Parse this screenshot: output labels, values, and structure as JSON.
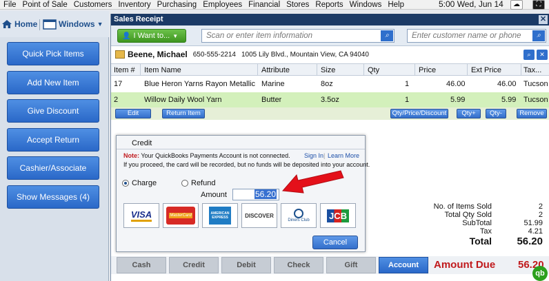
{
  "menu": [
    "File",
    "Point of Sale",
    "Customers",
    "Inventory",
    "Purchasing",
    "Employees",
    "Financial",
    "Stores",
    "Reports",
    "Windows",
    "Help"
  ],
  "clock": "5:00 Wed, Jun 14",
  "nav": {
    "home": "Home",
    "windows": "Windows"
  },
  "sidebar": [
    "Quick Pick Items",
    "Add New Item",
    "Give Discount",
    "Accept Return",
    "Cashier/Associate",
    "Show Messages (4)"
  ],
  "window": {
    "title": "Sales Receipt"
  },
  "toolbar": {
    "iwant": "I Want to...",
    "item_placeholder": "Scan or enter item information",
    "customer_placeholder": "Enter customer name or phone"
  },
  "customer": {
    "name": "Beene, Michael",
    "phone": "650-555-2214",
    "address": "1005 Lily Blvd., Mountain View, CA 94040"
  },
  "columns": [
    "Item #",
    "Item Name",
    "Attribute",
    "Size",
    "Qty",
    "Price",
    "Ext Price",
    "Tax..."
  ],
  "rows": [
    {
      "item": "17",
      "name": "Blue Heron Yarns Rayon Metallic",
      "attr": "Marine",
      "size": "8oz",
      "qty": "1",
      "price": "46.00",
      "ext": "46.00",
      "tax": "Tucson T"
    },
    {
      "item": "2",
      "name": "Willow Daily Wool Yarn",
      "attr": "Butter",
      "size": "3.5oz",
      "qty": "1",
      "price": "5.99",
      "ext": "5.99",
      "tax": "Tucson T"
    }
  ],
  "editbar": {
    "edit": "Edit",
    "ret": "Return Item",
    "qpd": "Qty/Price/Discount",
    "qplus": "Qty+",
    "qminus": "Qty-",
    "remove": "Remove"
  },
  "totals": [
    {
      "label": "No. of Items Sold",
      "value": "2"
    },
    {
      "label": "Total Qty Sold",
      "value": "2"
    },
    {
      "label": "SubTotal",
      "value": "51.99"
    },
    {
      "label": "Tax",
      "value": "4.21"
    }
  ],
  "total": {
    "label": "Total",
    "value": "56.20"
  },
  "pay": {
    "cash": "Cash",
    "credit": "Credit",
    "debit": "Debit",
    "check": "Check",
    "gift": "Gift",
    "account": "Account",
    "due_label": "Amount Due",
    "due_value": "56.20"
  },
  "qb": "qb",
  "dialog": {
    "title": "Credit",
    "note_label": "Note:",
    "note": "Your QuickBooks Payments Account is not connected.",
    "note2": "If you proceed, the card will be recorded, but no funds will be deposited into your account.",
    "sign_in": "Sign In",
    "learn_more": "Learn More",
    "charge": "Charge",
    "refund": "Refund",
    "amount_label": "Amount",
    "amount": "56.20",
    "cards": {
      "visa": "VISA",
      "mastercard": "MasterCard",
      "amex": "AMERICAN EXPRESS",
      "discover": "DISCOVER",
      "diners": "Diners Club",
      "jcb": "JCB"
    },
    "cancel": "Cancel"
  },
  "colors": {
    "accent": "#2f6fcc",
    "due": "#c0191c",
    "green_row": "#d3f0bb",
    "title": "#1b3a66"
  }
}
